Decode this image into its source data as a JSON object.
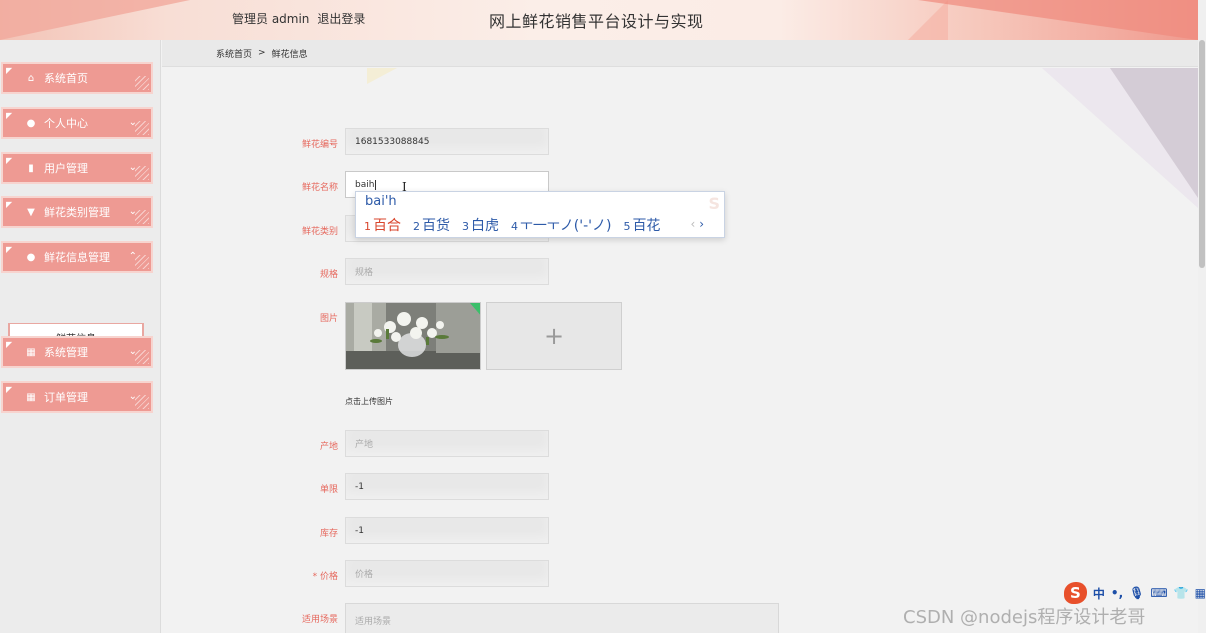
{
  "header": {
    "user_role": "管理员 admin",
    "logout": "退出登录",
    "title": "网上鲜花销售平台设计与实现"
  },
  "sidebar": {
    "items": [
      {
        "label": "系统首页",
        "icon": "home-icon",
        "expandable": false
      },
      {
        "label": "个人中心",
        "icon": "person-icon",
        "expandable": true
      },
      {
        "label": "用户管理",
        "icon": "chart-icon",
        "expandable": true
      },
      {
        "label": "鲜花类别管理",
        "icon": "shield-icon",
        "expandable": true
      },
      {
        "label": "鲜花信息管理",
        "icon": "person-icon",
        "expandable": true,
        "expanded": true
      },
      {
        "label": "系统管理",
        "icon": "grid-icon",
        "expandable": true
      },
      {
        "label": "订单管理",
        "icon": "grid-icon",
        "expandable": true
      }
    ],
    "sub_item": "鲜花信息"
  },
  "breadcrumb": {
    "home": "系统首页",
    "separator": ">",
    "current": "鲜花信息"
  },
  "form": {
    "flower_no": {
      "label": "鲜花编号",
      "value": "1681533088845"
    },
    "flower_name": {
      "label": "鲜花名称",
      "value": "baih"
    },
    "flower_category": {
      "label": "鲜花类别"
    },
    "spec": {
      "label": "规格",
      "placeholder": "规格"
    },
    "image": {
      "label": "图片",
      "upload_hint": "点击上传图片",
      "add_symbol": "+"
    },
    "origin": {
      "label": "产地",
      "placeholder": "产地"
    },
    "limit": {
      "label": "单限",
      "value": "-1"
    },
    "stock": {
      "label": "库存",
      "value": "-1"
    },
    "price": {
      "label": "价格",
      "required_mark": "*",
      "placeholder": "价格"
    },
    "scene": {
      "label": "适用场景",
      "placeholder": "适用场景"
    }
  },
  "ime": {
    "input": "bai'h",
    "candidates": [
      {
        "num": "1",
        "text": "百合"
      },
      {
        "num": "2",
        "text": "百货"
      },
      {
        "num": "3",
        "text": "白虎"
      },
      {
        "num": "4",
        "text": "ㅜ一ㅜノ('-'ノ)"
      },
      {
        "num": "5",
        "text": "百花"
      }
    ],
    "prev": "‹",
    "next": "›"
  },
  "tray": {
    "ime_logo": "S",
    "mode": "中",
    "punct": "•,"
  },
  "watermark": "CSDN @nodejs程序设计老哥"
}
